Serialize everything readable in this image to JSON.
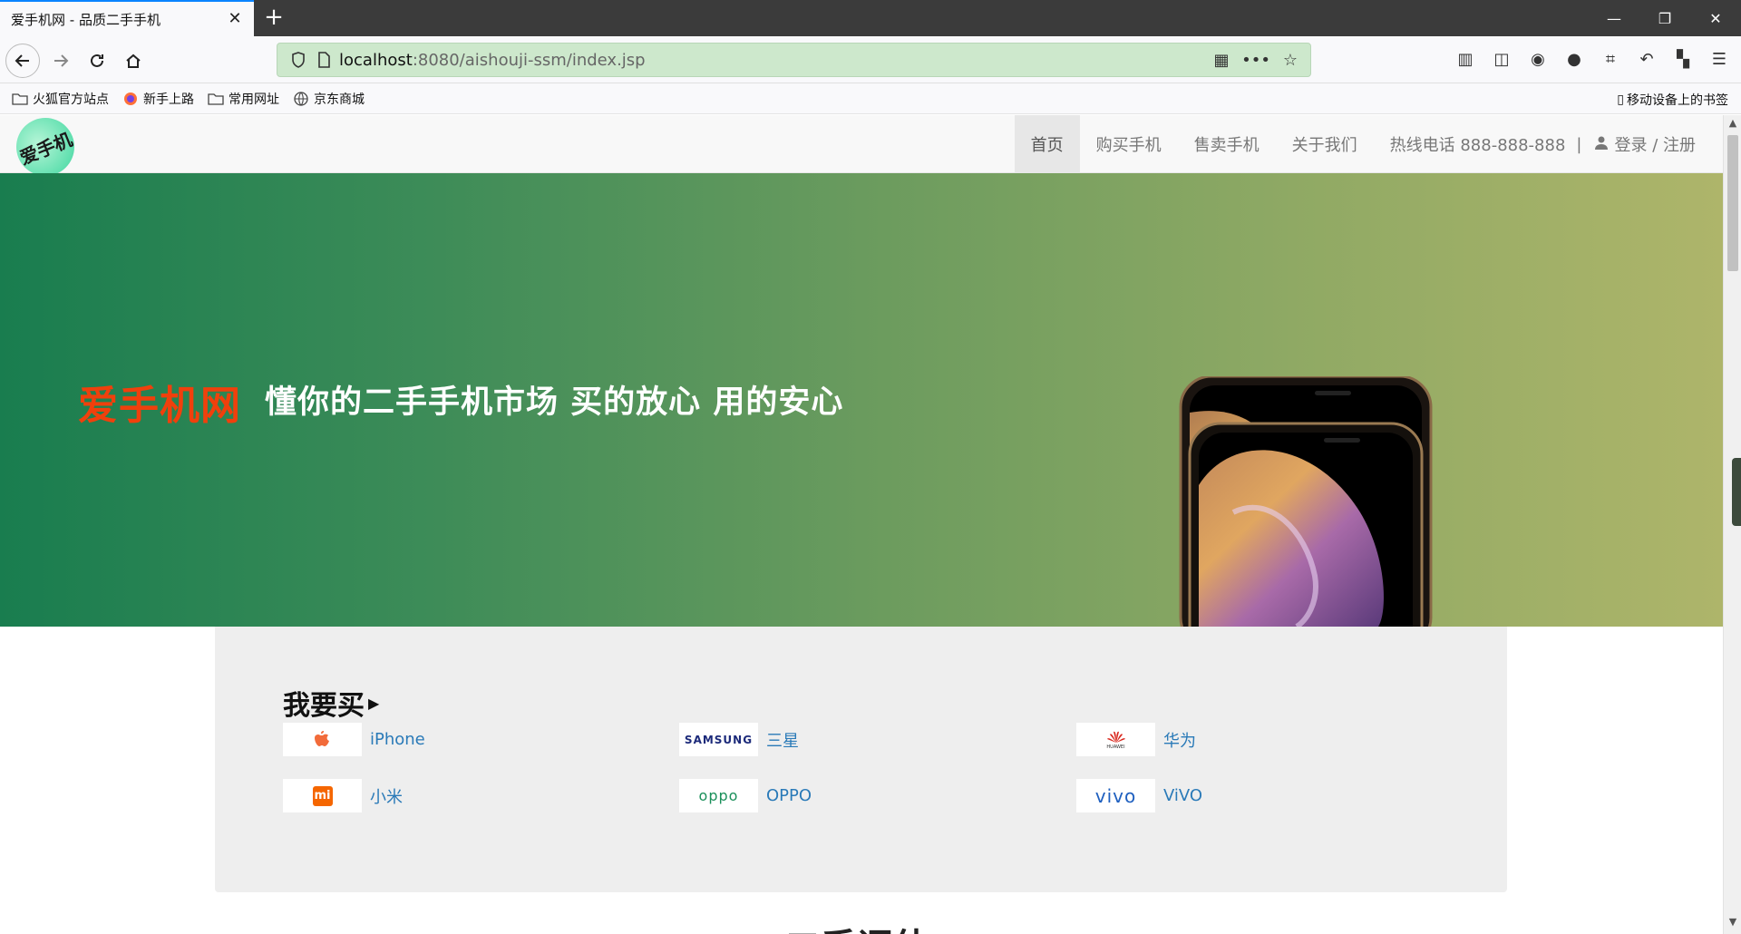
{
  "browser": {
    "tab_title": "爱手机网 - 品质二手手机",
    "url_host": "localhost",
    "url_path": ":8080/aishouji-ssm/index.jsp",
    "bookmarks": [
      "火狐官方站点",
      "新手上路",
      "常用网址",
      "京东商城"
    ],
    "mobile_bookmarks": "移动设备上的书签"
  },
  "site": {
    "logo_text": "爱手机",
    "nav": {
      "home": "首页",
      "buy": "购买手机",
      "sell": "售卖手机",
      "about": "关于我们",
      "hotline": "热线电话 888-888-888",
      "separator": "|",
      "login": "登录 / 注册"
    },
    "hero": {
      "brand": "爱手机网",
      "slogan": "懂你的二手手机市场 买的放心 用的安心"
    },
    "buy_section": {
      "title": "我要买",
      "brands": [
        {
          "name": "iPhone",
          "logo": "apple-logo"
        },
        {
          "name": "三星",
          "logo_text": "SAMSUNG"
        },
        {
          "name": "华为",
          "logo": "huawei-logo",
          "logo_text": "HUAWEI"
        },
        {
          "name": "小米",
          "logo": "mi-logo",
          "logo_text": "mi"
        },
        {
          "name": "OPPO",
          "logo_text": "oppo"
        },
        {
          "name": "ViVO",
          "logo_text": "vivo"
        }
      ]
    },
    "next_heading": "二手评估"
  },
  "colors": {
    "brand_red": "#f0400c",
    "link_blue": "#2a7ab8",
    "url_green": "#cde8cc"
  }
}
